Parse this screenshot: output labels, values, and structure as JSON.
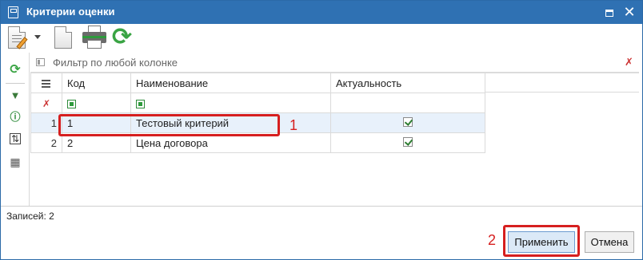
{
  "window": {
    "title": "Критерии оценки",
    "title_bar_color": "#2f71b3"
  },
  "toolbar": {
    "icons": [
      "edit-document-icon",
      "dropdown-arrow-icon",
      "new-document-icon",
      "print-icon",
      "refresh-icon"
    ]
  },
  "sidebar": {
    "icons": [
      "refresh-icon",
      "filter-icon",
      "info-icon",
      "sort-icon",
      "column-settings-icon"
    ]
  },
  "filter": {
    "placeholder": "Фильтр по любой колонке"
  },
  "grid": {
    "columns": [
      "Код",
      "Наименование",
      "Актуальность"
    ],
    "rows": [
      {
        "num": "1",
        "code": "1",
        "name": "Тестовый критерий",
        "active": true
      },
      {
        "num": "2",
        "code": "2",
        "name": "Цена договора",
        "active": true
      }
    ]
  },
  "annotations": {
    "one": "1",
    "two": "2",
    "color": "#d61f1f"
  },
  "footer": {
    "records": "Записей: 2",
    "apply_label": "Применить",
    "cancel_label": "Отмена"
  }
}
